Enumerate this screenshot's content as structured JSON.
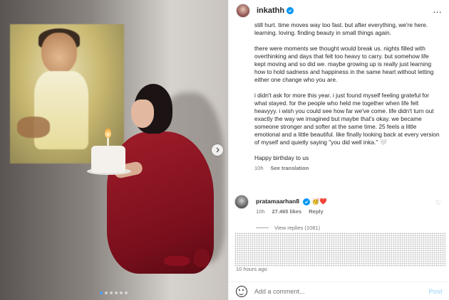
{
  "post": {
    "username": "inkathh",
    "more_icon": "…",
    "caption_paragraphs": [
      "still hurt. time moves way too fast. but after everything, we're here. learning. loving. finding beauty in small things again.",
      "there were moments we thought would break us. nights filled with overthinking and days that felt too heavy to carry. but somehow life kept moving and so did we. maybe growing up is really just learning how to hold sadness and happiness in the same heart without letting either one change who you are.",
      "i didn't ask for more this year. i just found myself feeling grateful for what stayed. for the people who held me together when life felt heavyyy. i wish you could see how far we've come. life didn't turn out exactly the way we imagined but maybe that's okay. we became someone stronger and softer at the same time. 25 feels a little emotional and a little beautiful. like finally looking back at every version of myself and quietly saying \"you did well inka.\" 🤍",
      "Happy birthday to us"
    ],
    "caption_time": "10h",
    "see_translation": "See translation"
  },
  "media": {
    "carousel_dots": 6,
    "active_dot": 0
  },
  "comment": {
    "username": "pratamaarhan8",
    "text": "🥳❤️",
    "time": "10h",
    "likes": "27.465 likes",
    "reply": "Reply",
    "view_replies": "View replies (1081)"
  },
  "hidden_comment": {
    "time_ago": "10 hours ago"
  },
  "footer": {
    "placeholder": "Add a comment...",
    "post_label": "Post"
  },
  "colors": {
    "accent": "#0095f6",
    "post_disabled": "#b2dffc",
    "dress": "#a01c2a"
  }
}
